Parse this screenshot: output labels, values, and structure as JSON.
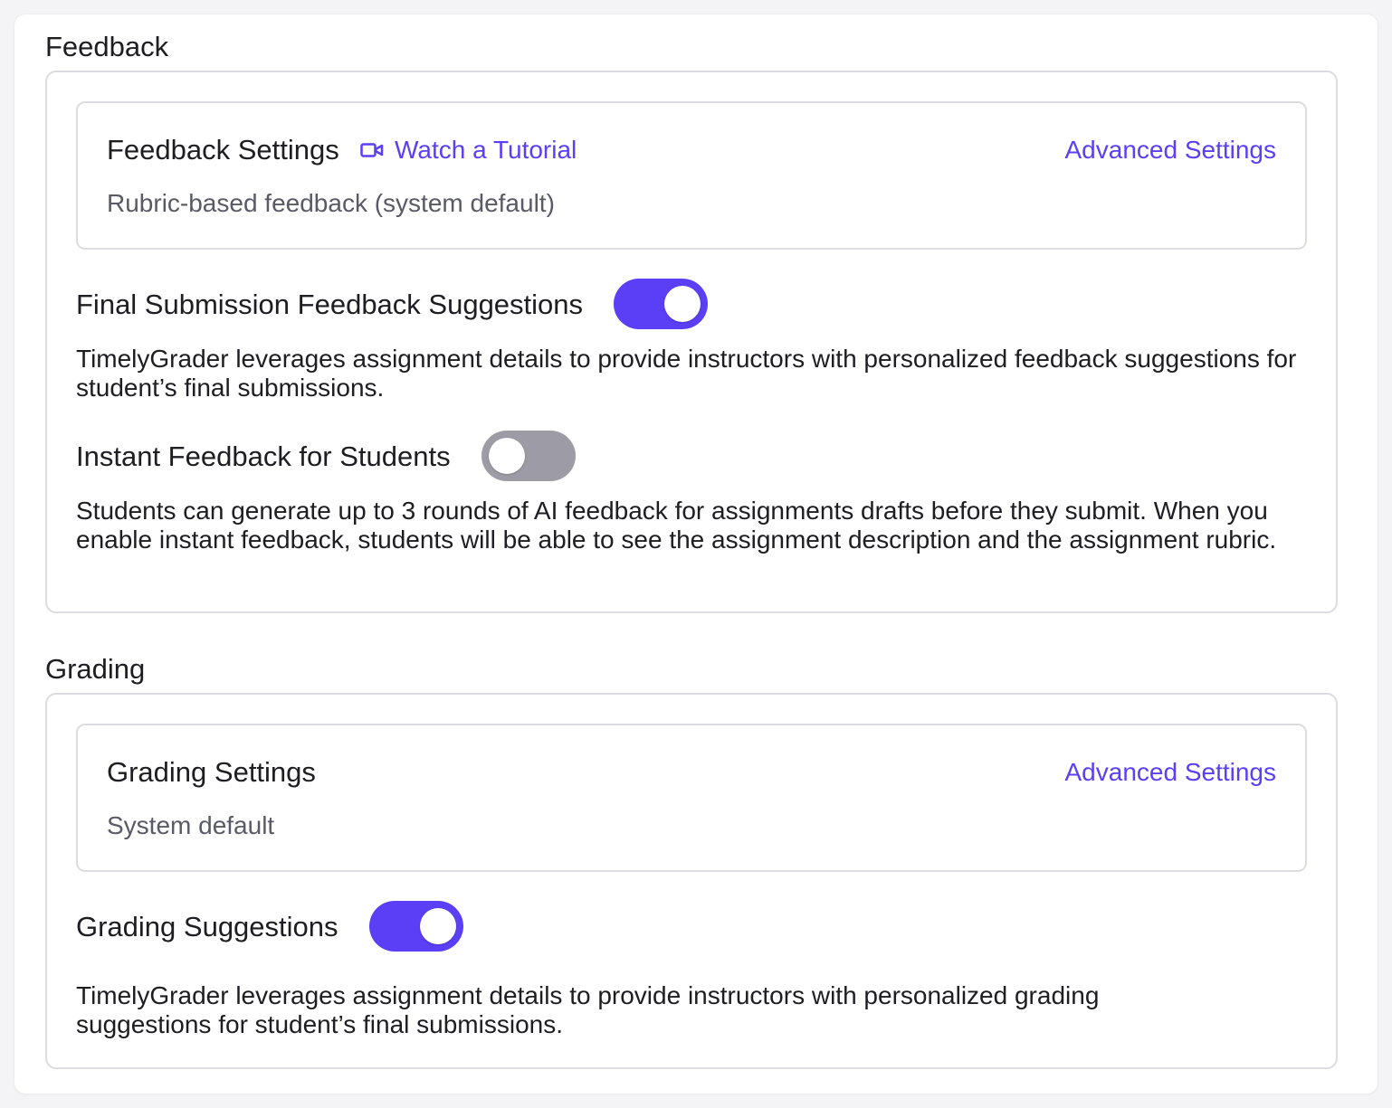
{
  "feedback": {
    "section_title": "Feedback",
    "settings_card": {
      "title": "Feedback Settings",
      "tutorial_label": "Watch a Tutorial",
      "tutorial_icon": "video-camera-icon",
      "advanced_label": "Advanced Settings",
      "subtitle": "Rubric-based feedback (system default)"
    },
    "final_submission": {
      "label": "Final Submission Feedback Suggestions",
      "enabled": true,
      "description": "TimelyGrader leverages assignment details to provide instructors with personalized feedback suggestions for student’s final submissions."
    },
    "instant_feedback": {
      "label": "Instant Feedback for Students",
      "enabled": false,
      "description": "Students can generate up to 3 rounds of AI feedback for assignments drafts before they submit. When you enable instant feedback, students will be able to see the assignment description and the assignment rubric."
    }
  },
  "grading": {
    "section_title": "Grading",
    "settings_card": {
      "title": "Grading Settings",
      "advanced_label": "Advanced Settings",
      "subtitle": "System default"
    },
    "grading_suggestions": {
      "label": "Grading Suggestions",
      "enabled": true,
      "description": "TimelyGrader leverages assignment details to provide instructors with personalized grading suggestions for student’s final submissions."
    }
  },
  "colors": {
    "accent": "#5b3ff6",
    "toggle_off": "#9d9ca6",
    "border": "#dcdce1",
    "muted_text": "#5a5a66"
  }
}
